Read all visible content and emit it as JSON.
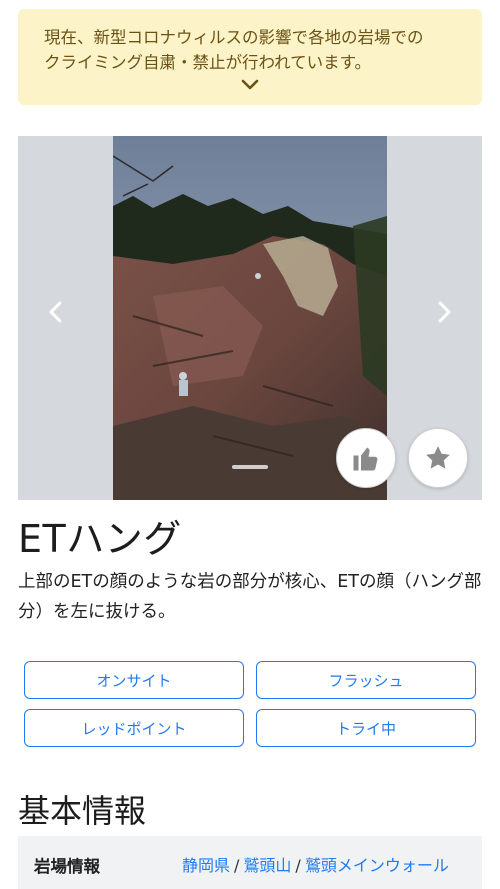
{
  "notice": {
    "line1": "現在、新型コロナウィルスの影響で各地の岩場での",
    "line2": "クライミング自粛・禁止が行われています。",
    "expand_icon": "chevron-down-icon"
  },
  "carousel": {
    "prev_icon": "chevron-left-icon",
    "next_icon": "chevron-right-icon",
    "like_icon": "thumbs-up-icon",
    "favorite_icon": "star-icon"
  },
  "route": {
    "title": "ETハング",
    "description": "上部のETの顔のような岩の部分が核心、ETの顔（ハング部分）を左に抜ける。"
  },
  "record_buttons": [
    "オンサイト",
    "フラッシュ",
    "レッドポイント",
    "トライ中"
  ],
  "basic_info": {
    "heading": "基本情報",
    "label": "岩場情報",
    "crumbs": [
      "静岡県",
      "鷲頭山",
      "鷲頭メインウォール"
    ],
    "separator": "/"
  },
  "colors": {
    "accent": "#1f7bf2",
    "notice_bg": "#fdf3c8",
    "notice_text": "#6b5315"
  }
}
